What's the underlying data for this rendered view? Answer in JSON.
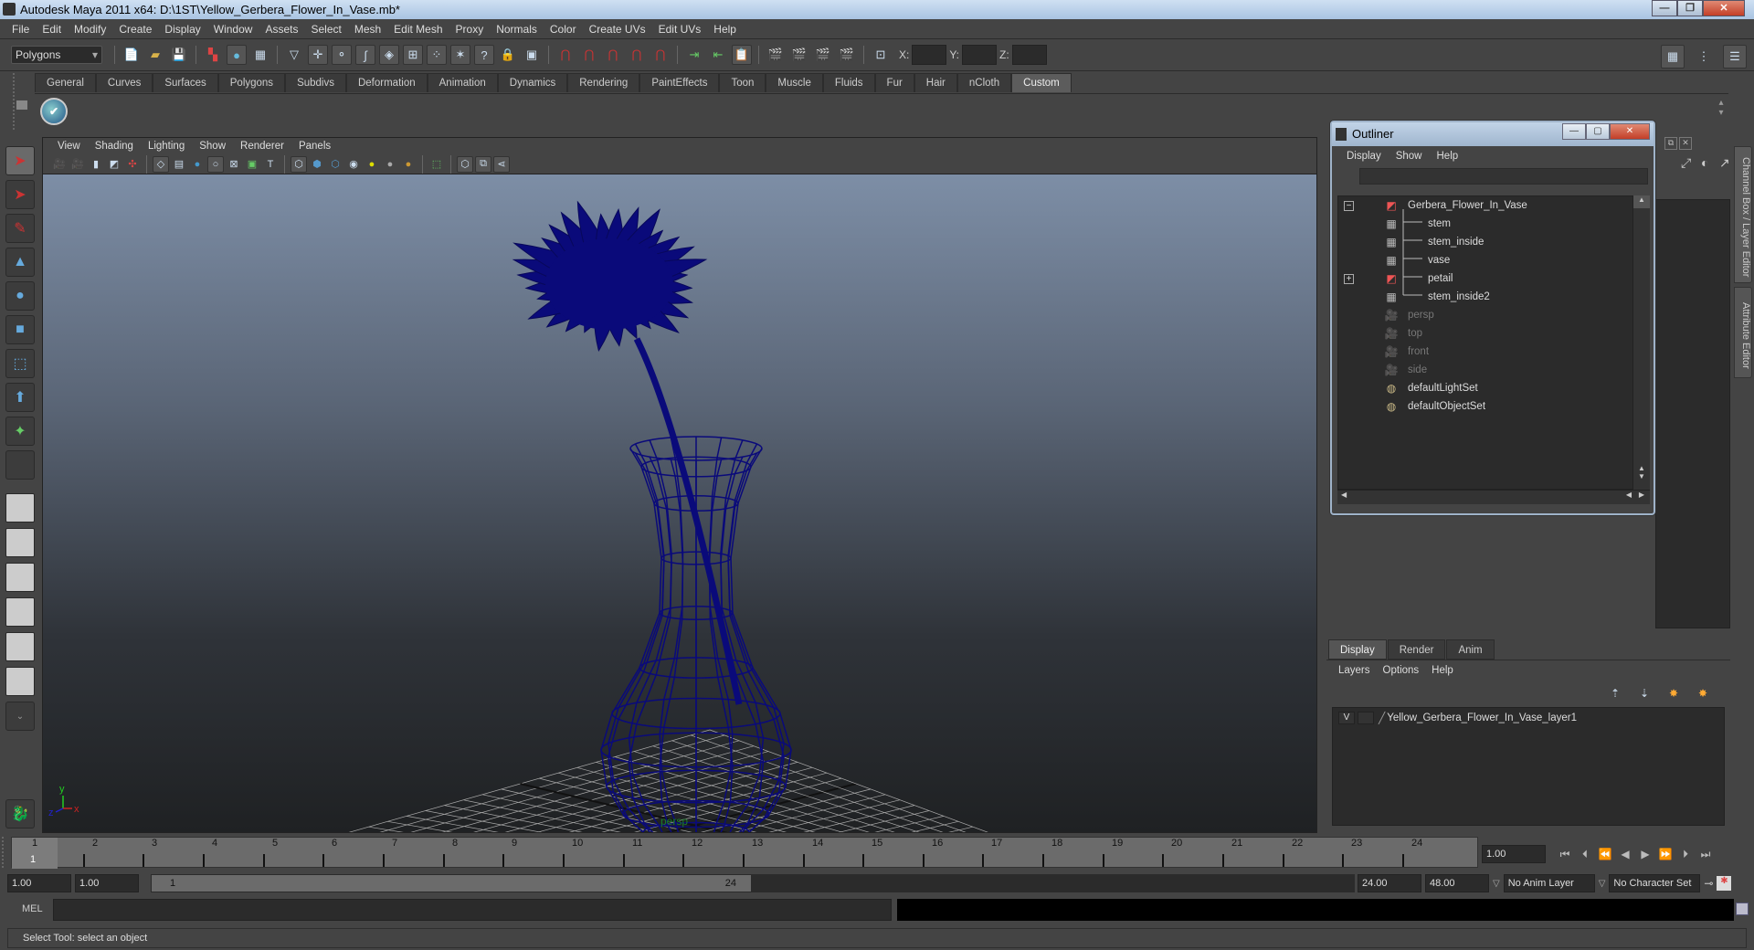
{
  "window": {
    "title": "Autodesk Maya 2011 x64: D:\\1ST\\Yellow_Gerbera_Flower_In_Vase.mb*",
    "controls": [
      "minimize",
      "restore",
      "close"
    ]
  },
  "menubar": [
    "File",
    "Edit",
    "Modify",
    "Create",
    "Display",
    "Window",
    "Assets",
    "Select",
    "Mesh",
    "Edit Mesh",
    "Proxy",
    "Normals",
    "Color",
    "Create UVs",
    "Edit UVs",
    "Help"
  ],
  "statusline": {
    "menuset": "Polygons",
    "xyz_labels": [
      "X:",
      "Y:",
      "Z:"
    ],
    "xyz_values": [
      "",
      "",
      ""
    ]
  },
  "shelf": {
    "tabs": [
      "General",
      "Curves",
      "Surfaces",
      "Polygons",
      "Subdivs",
      "Deformation",
      "Animation",
      "Dynamics",
      "Rendering",
      "PaintEffects",
      "Toon",
      "Muscle",
      "Fluids",
      "Fur",
      "Hair",
      "nCloth",
      "Custom"
    ],
    "active_tab": "Custom"
  },
  "viewport": {
    "menu": [
      "View",
      "Shading",
      "Lighting",
      "Show",
      "Renderer",
      "Panels"
    ],
    "camera_label": "persp",
    "axis_labels": [
      "y",
      "x",
      "z"
    ],
    "wire_color": "#0a0a7a"
  },
  "outliner": {
    "title": "Outliner",
    "menu": [
      "Display",
      "Show",
      "Help"
    ],
    "items": [
      {
        "label": "Gerbera_Flower_In_Vase",
        "icon": "transform-icon",
        "expander": "−",
        "indent": 0,
        "dim": false
      },
      {
        "label": "stem",
        "icon": "mesh-icon",
        "expander": "",
        "indent": 1,
        "dim": false
      },
      {
        "label": "stem_inside",
        "icon": "mesh-icon",
        "expander": "",
        "indent": 1,
        "dim": false
      },
      {
        "label": "vase",
        "icon": "mesh-icon",
        "expander": "",
        "indent": 1,
        "dim": false
      },
      {
        "label": "petail",
        "icon": "transform-icon",
        "expander": "+",
        "indent": 1,
        "dim": false
      },
      {
        "label": "stem_inside2",
        "icon": "mesh-icon",
        "expander": "",
        "indent": 1,
        "dim": false
      },
      {
        "label": "persp",
        "icon": "camera-icon",
        "expander": "",
        "indent": 0,
        "dim": true
      },
      {
        "label": "top",
        "icon": "camera-icon",
        "expander": "",
        "indent": 0,
        "dim": true
      },
      {
        "label": "front",
        "icon": "camera-icon",
        "expander": "",
        "indent": 0,
        "dim": true
      },
      {
        "label": "side",
        "icon": "camera-icon",
        "expander": "",
        "indent": 0,
        "dim": true
      },
      {
        "label": "defaultLightSet",
        "icon": "set-icon",
        "expander": "",
        "indent": 0,
        "dim": false
      },
      {
        "label": "defaultObjectSet",
        "icon": "set-icon",
        "expander": "",
        "indent": 0,
        "dim": false
      }
    ]
  },
  "side_tabs": [
    "Channel Box / Layer Editor",
    "Attribute Editor"
  ],
  "layer_editor": {
    "tabs": [
      "Display",
      "Render",
      "Anim"
    ],
    "active_tab": "Display",
    "menu": [
      "Layers",
      "Options",
      "Help"
    ],
    "layers": [
      {
        "visible": "V",
        "name": "Yellow_Gerbera_Flower_In_Vase_layer1"
      }
    ]
  },
  "timeline": {
    "ticks": [
      "1",
      "2",
      "3",
      "4",
      "5",
      "6",
      "7",
      "8",
      "9",
      "10",
      "11",
      "12",
      "13",
      "14",
      "15",
      "16",
      "17",
      "18",
      "19",
      "20",
      "21",
      "22",
      "23",
      "24"
    ],
    "current_frame": "1",
    "current_time_field": "1.00",
    "playback_buttons": [
      "go-to-start",
      "step-back-key",
      "step-back-frame",
      "play-backward",
      "play-forward",
      "step-forward-frame",
      "step-forward-key",
      "go-to-end"
    ]
  },
  "range": {
    "start_time": "1.00",
    "playback_start": "1.00",
    "slider_start": "1",
    "slider_end": "24",
    "playback_end": "24.00",
    "end_time": "48.00",
    "anim_layer": "No Anim Layer",
    "character_set": "No Character Set"
  },
  "command_line": {
    "label": "MEL",
    "value": ""
  },
  "help_line": "Select Tool: select an object"
}
